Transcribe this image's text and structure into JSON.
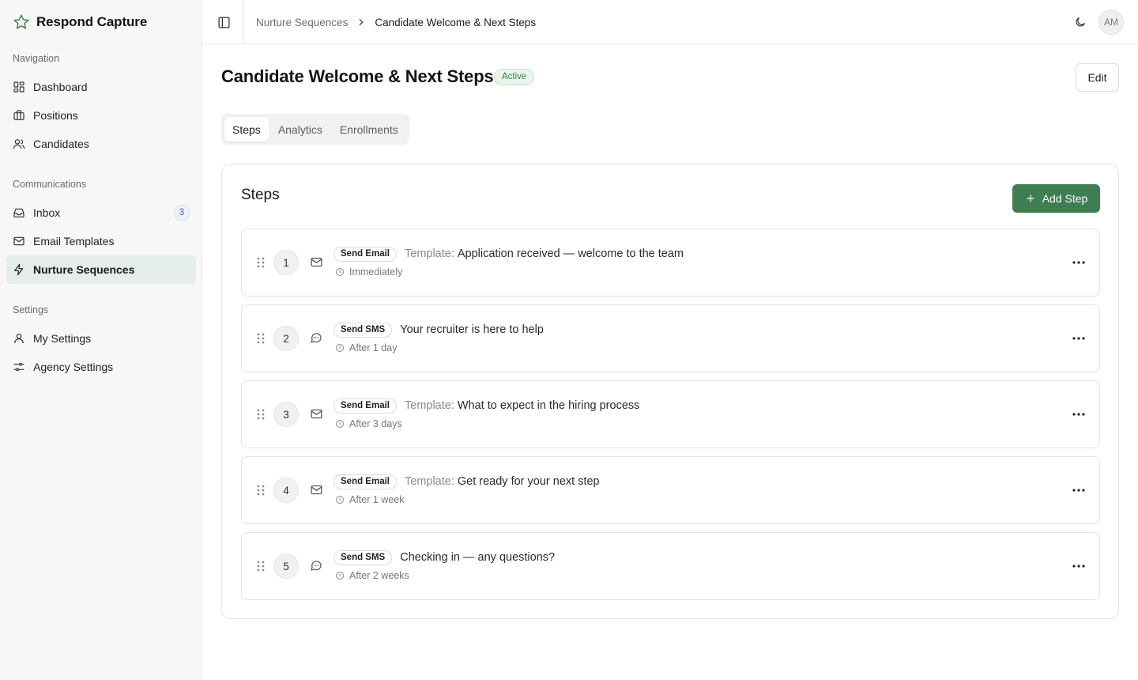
{
  "app": {
    "name": "Respond Capture"
  },
  "sidebar": {
    "sections": [
      {
        "heading": "Navigation",
        "items": [
          {
            "label": "Dashboard",
            "icon": "dashboard-icon"
          },
          {
            "label": "Positions",
            "icon": "briefcase-icon"
          },
          {
            "label": "Candidates",
            "icon": "users-icon"
          }
        ]
      },
      {
        "heading": "Communications",
        "items": [
          {
            "label": "Inbox",
            "icon": "inbox-icon",
            "badge": "3"
          },
          {
            "label": "Email Templates",
            "icon": "mail-icon"
          },
          {
            "label": "Nurture Sequences",
            "icon": "zap-icon",
            "active": true
          }
        ]
      },
      {
        "heading": "Settings",
        "items": [
          {
            "label": "My Settings",
            "icon": "user-icon"
          },
          {
            "label": "Agency Settings",
            "icon": "sliders-icon"
          }
        ]
      }
    ]
  },
  "topbar": {
    "breadcrumb": {
      "parent": "Nurture Sequences",
      "current": "Candidate Welcome & Next Steps"
    },
    "avatar_initials": "AM"
  },
  "page": {
    "title": "Candidate Welcome & Next Steps",
    "status": "Active",
    "edit_label": "Edit",
    "tabs": [
      {
        "label": "Steps",
        "active": true
      },
      {
        "label": "Analytics",
        "active": false
      },
      {
        "label": "Enrollments",
        "active": false
      }
    ]
  },
  "steps_card": {
    "title": "Steps",
    "add_label": "Add Step",
    "steps": [
      {
        "number": "1",
        "type": "email",
        "action": "Send Email",
        "template_label": "Template:",
        "text": "Application received — welcome to the team",
        "timing": "Immediately"
      },
      {
        "number": "2",
        "type": "sms",
        "action": "Send SMS",
        "template_label": "",
        "text": "Your recruiter is here to help",
        "timing": "After 1 day"
      },
      {
        "number": "3",
        "type": "email",
        "action": "Send Email",
        "template_label": "Template:",
        "text": "What to expect in the hiring process",
        "timing": "After 3 days"
      },
      {
        "number": "4",
        "type": "email",
        "action": "Send Email",
        "template_label": "Template:",
        "text": "Get ready for your next step",
        "timing": "After 1 week"
      },
      {
        "number": "5",
        "type": "sms",
        "action": "Send SMS",
        "template_label": "",
        "text": "Checking in — any questions?",
        "timing": "After 2 weeks"
      }
    ]
  },
  "colors": {
    "accent": "#3f7d52",
    "active_nav_bg": "#e4ede7",
    "status_green": "#2f7d3e"
  }
}
